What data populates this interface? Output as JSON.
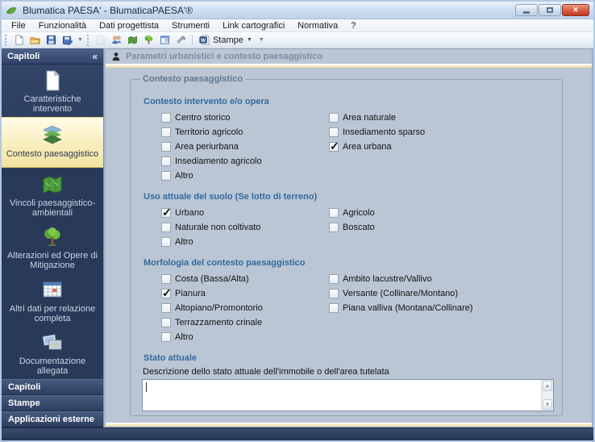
{
  "window": {
    "title": "Blumatica PAESA' - BlumaticaPAESA'®",
    "app_icon": "leaf-icon",
    "controls": [
      {
        "name": "minimize-button",
        "icon": "minimize-icon"
      },
      {
        "name": "maximize-button",
        "icon": "maximize-icon"
      },
      {
        "name": "close-button",
        "icon": "close-icon"
      }
    ]
  },
  "menu": {
    "items": [
      "File",
      "Funzionalità",
      "Dati progettista",
      "Strumenti",
      "Link cartografici",
      "Normativa",
      "?"
    ]
  },
  "toolbar": {
    "group1_icons": [
      "new-document-icon",
      "open-folder-icon",
      "save-icon",
      "save-as-icon"
    ],
    "group2_icons": [
      "page-disabled-icon",
      "users-icon",
      "map-icon",
      "tree-icon",
      "window-icon",
      "tools-icon"
    ],
    "stampe_label": "Stampe",
    "stampe_icon": "word-document-icon",
    "dropdown_glyph": "▼",
    "overflow_glyph": "▼"
  },
  "sidebar": {
    "header": "Capitoli",
    "collapse_glyph": "«",
    "items": [
      {
        "label": "Caratteristiche intervento",
        "icon": "document-icon",
        "selected": false
      },
      {
        "label": "Contesto paesaggistico",
        "icon": "map-layers-icon",
        "selected": true
      },
      {
        "label": "Vincoli paesaggistico-ambientali",
        "icon": "folded-map-icon",
        "selected": false
      },
      {
        "label": "Alterazioni ed Opere di Mitigazione",
        "icon": "tree-icon",
        "selected": false
      },
      {
        "label": "Altri dati per relazione completa",
        "icon": "data-table-icon",
        "selected": false
      },
      {
        "label": "Documentazione allegata",
        "icon": "photos-icon",
        "selected": false
      }
    ],
    "bottom_sections": [
      "Capitoli",
      "Stampe",
      "Applicazioni esterne"
    ]
  },
  "main": {
    "header": {
      "title": "Parametri urbanistici e contesto paesaggistico",
      "icon": "person-icon"
    },
    "groupbox_legend": "Contesto paesaggistico",
    "sections": [
      {
        "heading": "Contesto intervento e/o opera",
        "left": [
          {
            "label": "Centro storico",
            "checked": false
          },
          {
            "label": "Territorio agricolo",
            "checked": false
          },
          {
            "label": "Area periurbana",
            "checked": false
          },
          {
            "label": "Insediamento agricolo",
            "checked": false
          },
          {
            "label": "Altro",
            "checked": false
          }
        ],
        "right": [
          {
            "label": "Area naturale",
            "checked": false
          },
          {
            "label": "Insediamento sparso",
            "checked": false
          },
          {
            "label": "Area urbana",
            "checked": true
          }
        ]
      },
      {
        "heading": "Uso attuale del suolo (Se lotto di terreno)",
        "left": [
          {
            "label": "Urbano",
            "checked": true
          },
          {
            "label": "Naturale non coltivato",
            "checked": false
          },
          {
            "label": "Altro",
            "checked": false
          }
        ],
        "right": [
          {
            "label": "Agricolo",
            "checked": false
          },
          {
            "label": "Boscato",
            "checked": false
          }
        ]
      },
      {
        "heading": "Morfologia del contesto paesaggistico",
        "left": [
          {
            "label": "Costa (Bassa/Alta)",
            "checked": false
          },
          {
            "label": "Pianura",
            "checked": true
          },
          {
            "label": "Altopiano/Promontorio",
            "checked": false
          },
          {
            "label": "Terrazzamento crinale",
            "checked": false
          },
          {
            "label": "Altro",
            "checked": false
          }
        ],
        "right": [
          {
            "label": "Ambito lacustre/Vallivo",
            "checked": false
          },
          {
            "label": "Versante (Collinare/Montano)",
            "checked": false
          },
          {
            "label": "Piana valliva (Montana/Collinare)",
            "checked": false
          }
        ]
      }
    ],
    "stato_attuale": {
      "heading": "Stato attuale",
      "description_label": "Descrizione dello stato attuale dell'immobile o dell'area tutelata",
      "value": ""
    }
  },
  "colors": {
    "sidebar_bg": "#2e4060",
    "selected_item_bg": "#f7ecba",
    "accent_line": "#e6d9a0",
    "section_heading_blue": "#34699f",
    "statusbar_bg": "#2b3c59",
    "close_button_red": "#c03a22"
  }
}
